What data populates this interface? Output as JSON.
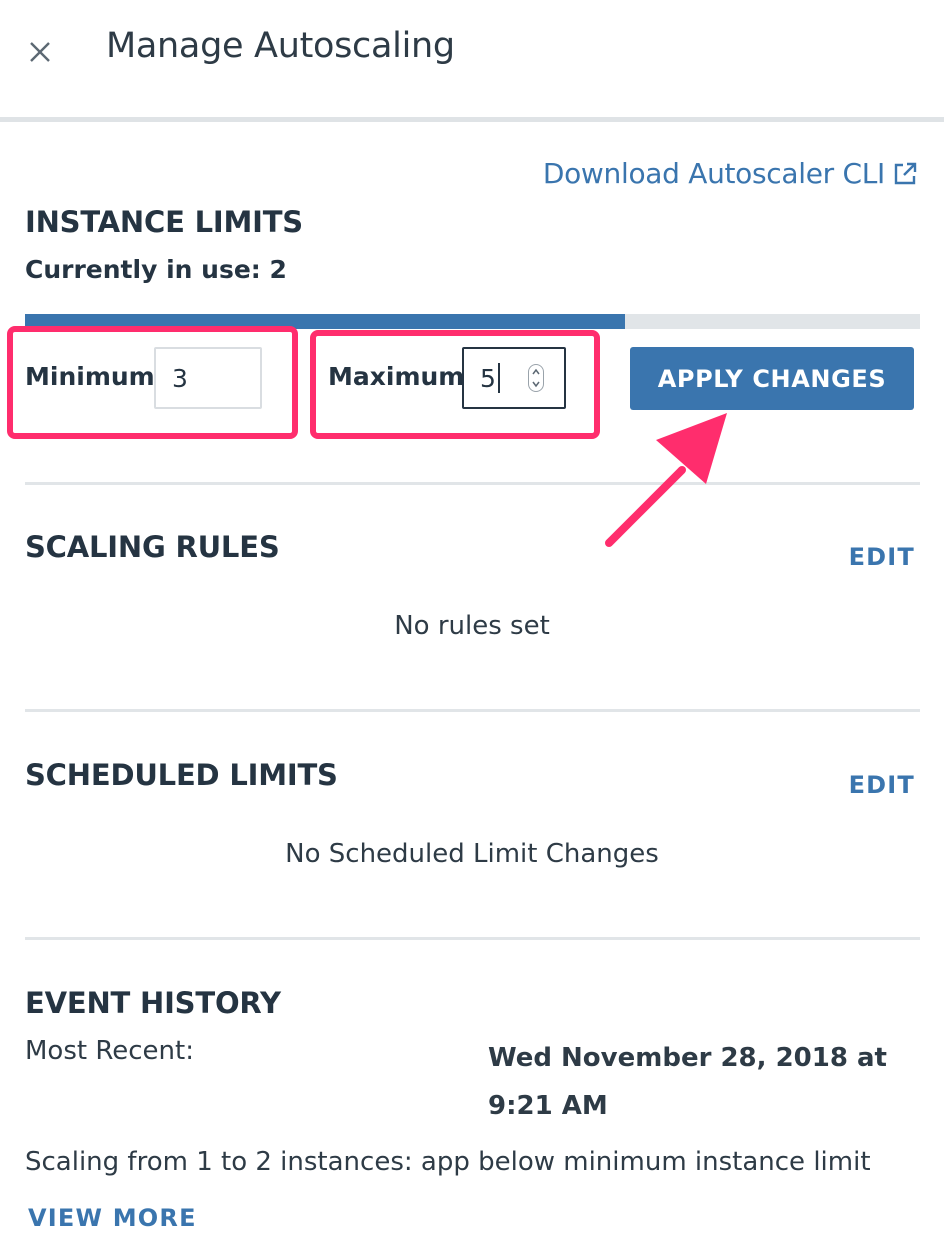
{
  "header": {
    "title": "Manage Autoscaling",
    "close_icon": "close-icon"
  },
  "download_link": {
    "label": "Download Autoscaler CLI",
    "icon": "external-link-icon"
  },
  "instance_limits": {
    "title": "INSTANCE LIMITS",
    "in_use_text": "Currently in use: 2",
    "usage_fraction": 0.67,
    "minimum_label": "Minimum",
    "minimum_value": "3",
    "maximum_label": "Maximum",
    "maximum_value": "5",
    "apply_label": "APPLY CHANGES"
  },
  "scaling_rules": {
    "title": "SCALING RULES",
    "edit_label": "EDIT",
    "empty_text": "No rules set"
  },
  "scheduled_limits": {
    "title": "SCHEDULED LIMITS",
    "edit_label": "EDIT",
    "empty_text": "No Scheduled Limit Changes"
  },
  "event_history": {
    "title": "EVENT HISTORY",
    "most_recent_label": "Most Recent:",
    "most_recent_date": "Wed November 28, 2018 at 9:21 AM",
    "event_text": "Scaling from 1 to 2 instances: app below minimum instance limit",
    "view_more_label": "VIEW MORE"
  },
  "colors": {
    "accent": "#3a75ae",
    "highlight": "#ff2d6d",
    "text": "#253442"
  }
}
